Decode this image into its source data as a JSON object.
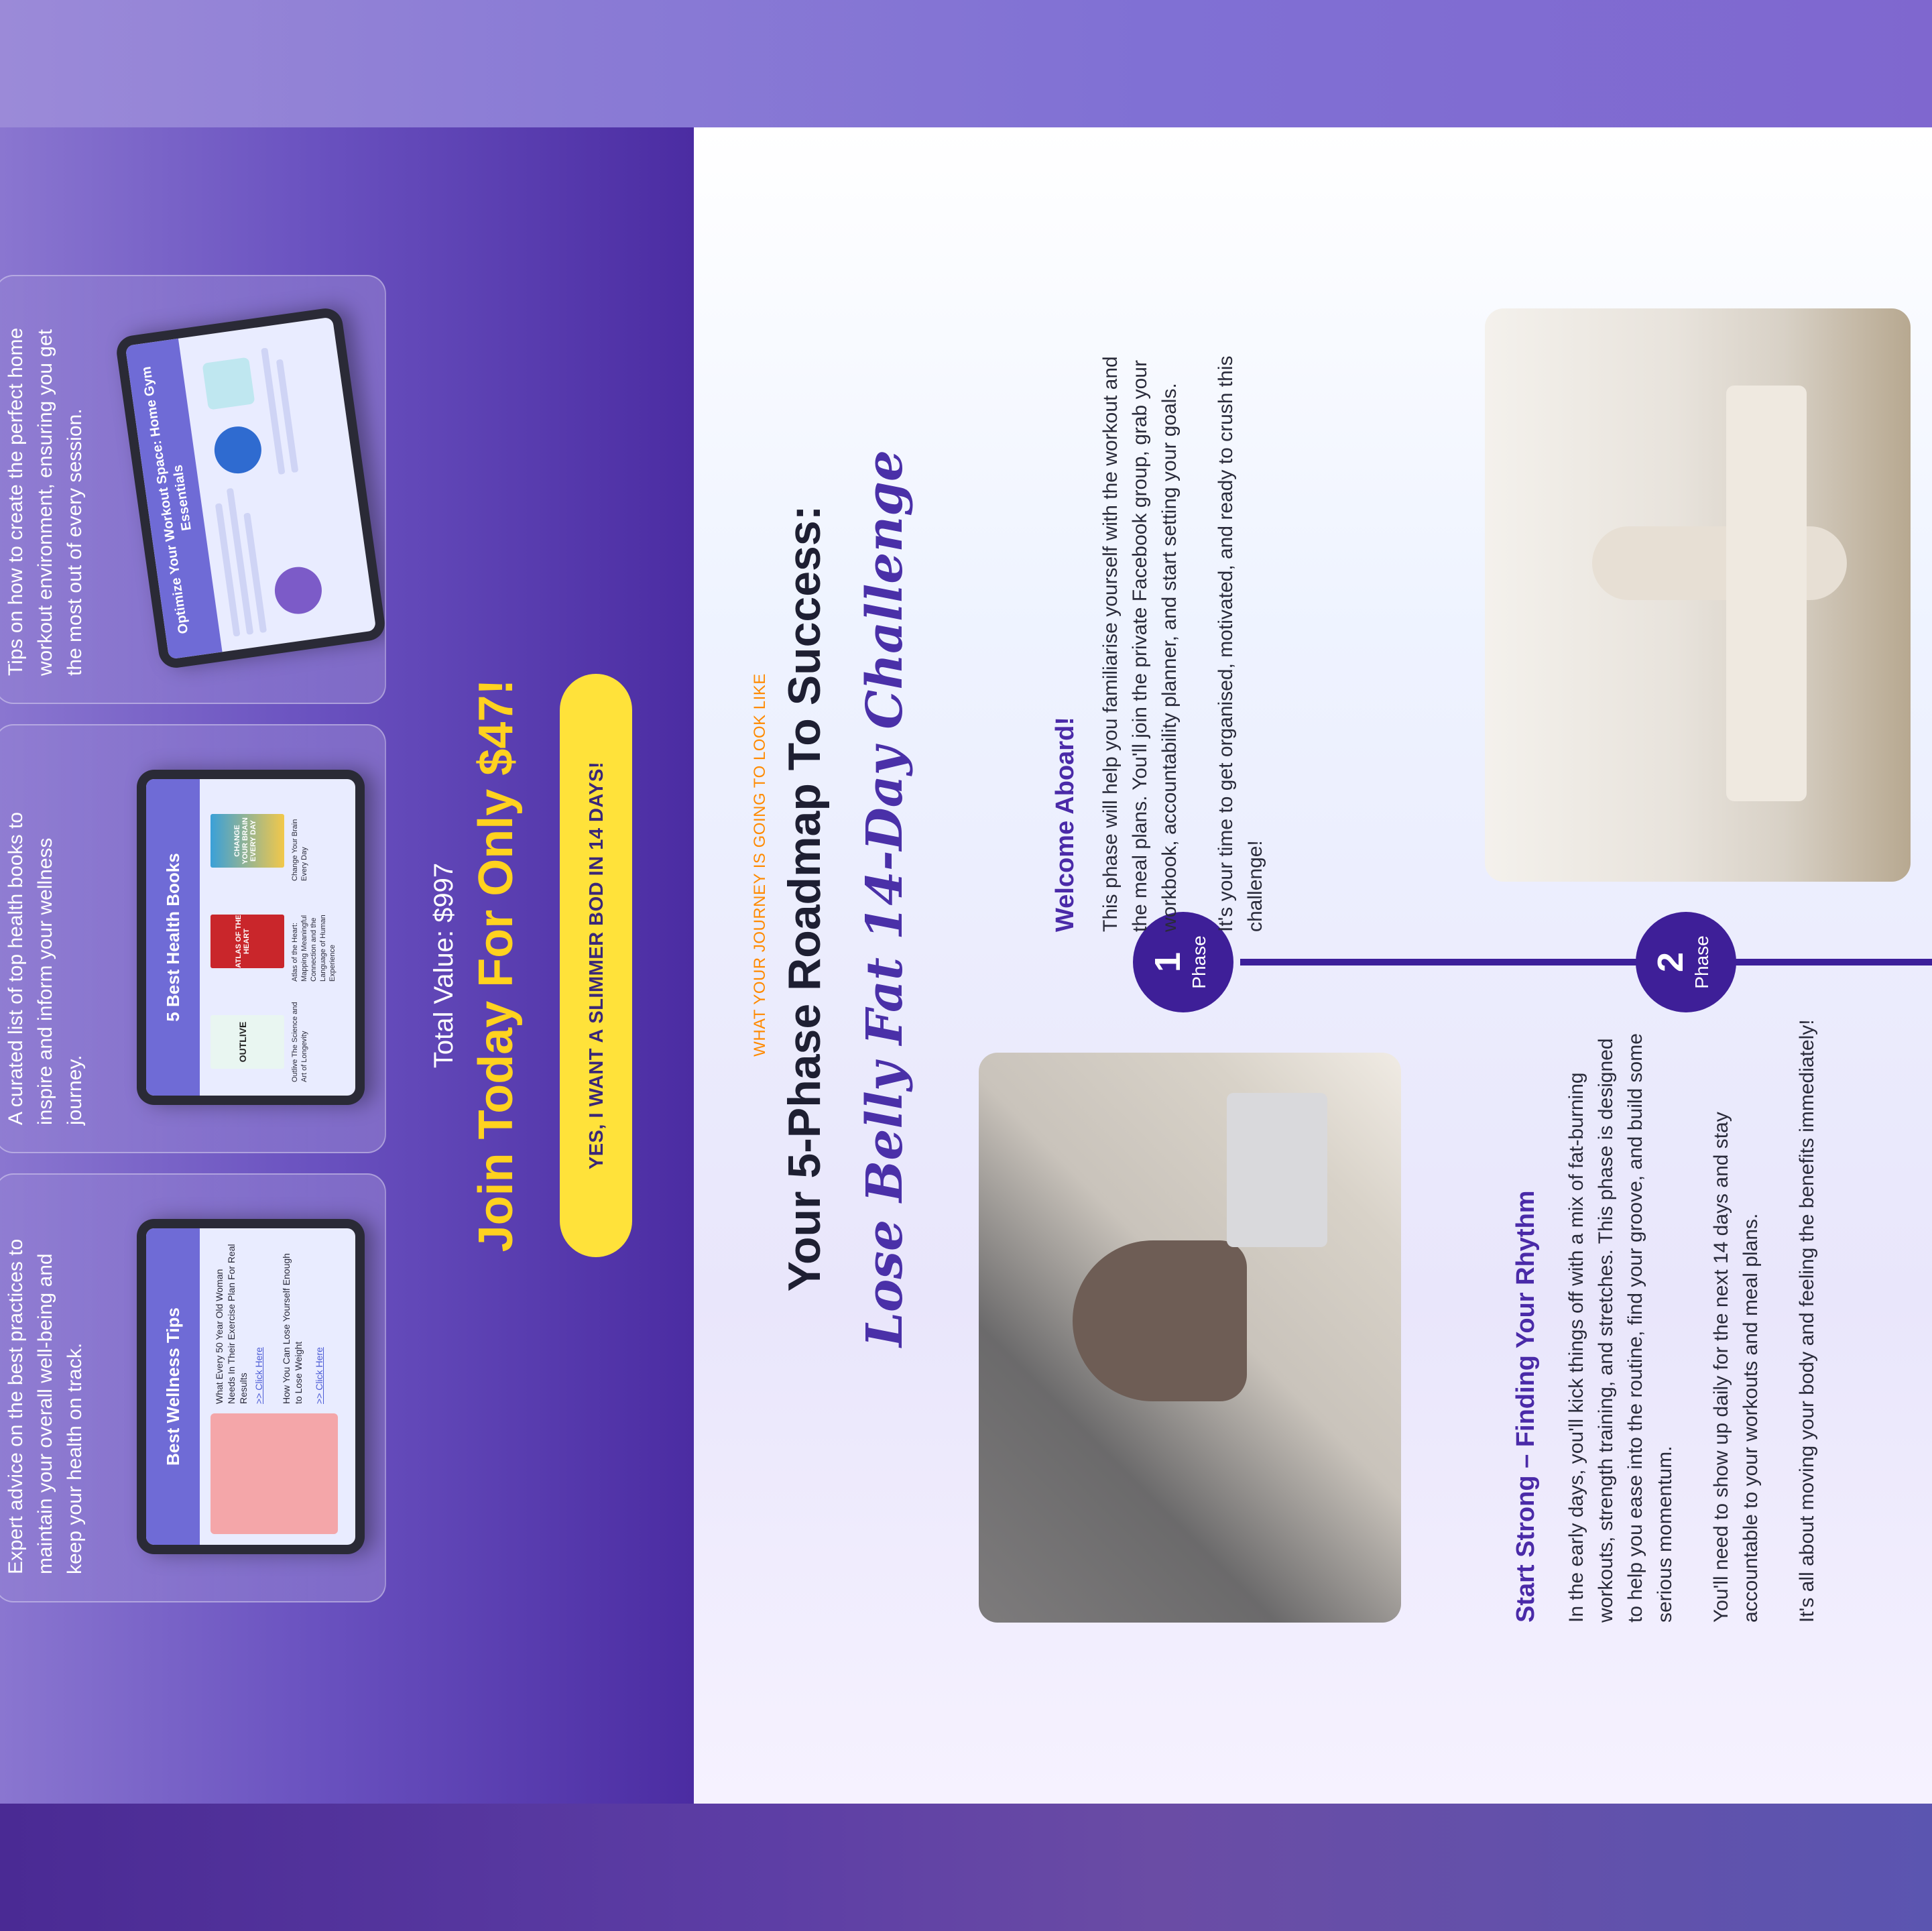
{
  "features": [
    {
      "text": "Expert advice on the best practices to maintain your overall well-being and keep your health on track.",
      "screen_title": "Best Wellness Tips",
      "items": [
        "What Every 50 Year Old Woman Needs In Their Exercise Plan For Real Results",
        "How You Can Lose Yourself Enough to Lose Weight"
      ],
      "link": ">> Click Here"
    },
    {
      "text": "A curated list of top health books to inspire and inform your wellness journey.",
      "screen_title": "5 Best Health Books",
      "items": [
        "Outlive The Science and Art of Longevity",
        "Atlas of the Heart: Mapping Meaningful Connection and the Language of Human Experience",
        "Change Your Brain Every Day"
      ],
      "book_titles": [
        "OUTLIVE",
        "ATLAS OF THE HEART",
        "CHANGE YOUR BRAIN EVERY DAY"
      ]
    },
    {
      "text": "Tips on how to create the perfect home workout environment, ensuring you get the most out of every session.",
      "screen_title": "Optimize Your Workout Space: Home Gym Essentials"
    }
  ],
  "offer": {
    "total_value": "Total Value: $997",
    "join": "Join Today For Only $47!",
    "cta": "YES, I WANT A SLIMMER BOD IN 14 DAYS!"
  },
  "roadmap": {
    "eyebrow": "WHAT YOUR JOURNEY IS GOING TO LOOK LIKE",
    "headline": "Your 5-Phase Roadmap To Success:",
    "subheadline": "Lose Belly Fat 14-Day Challenge"
  },
  "phases": [
    {
      "number": "1",
      "label": "Phase",
      "title": "Welcome Aboard!",
      "paragraphs": [
        "This phase will help you familiarise yourself with the workout and the meal plans. You'll join the private Facebook group, grab your workbook, accountability planner, and start setting your goals.",
        "It's your time to get organised, motivated, and ready to crush this challenge!"
      ]
    },
    {
      "number": "2",
      "label": "Phase",
      "title": "Start Strong – Finding Your Rhythm",
      "paragraphs": [
        "In the early days, you'll kick things off with a mix of fat-burning workouts, strength training, and stretches. This phase is designed to help you ease into the routine, find your groove, and build some serious momentum.",
        "You'll need to show up daily for the next 14 days and stay accountable to your workouts and meal plans.",
        "It's all about moving your body and feeling the benefits immediately!"
      ]
    }
  ],
  "colors": {
    "accent_yellow": "#ffd21f",
    "cta_bg": "#ffe23a",
    "brand_purple": "#3e1f98",
    "eyebrow_orange": "#ff8a00"
  }
}
